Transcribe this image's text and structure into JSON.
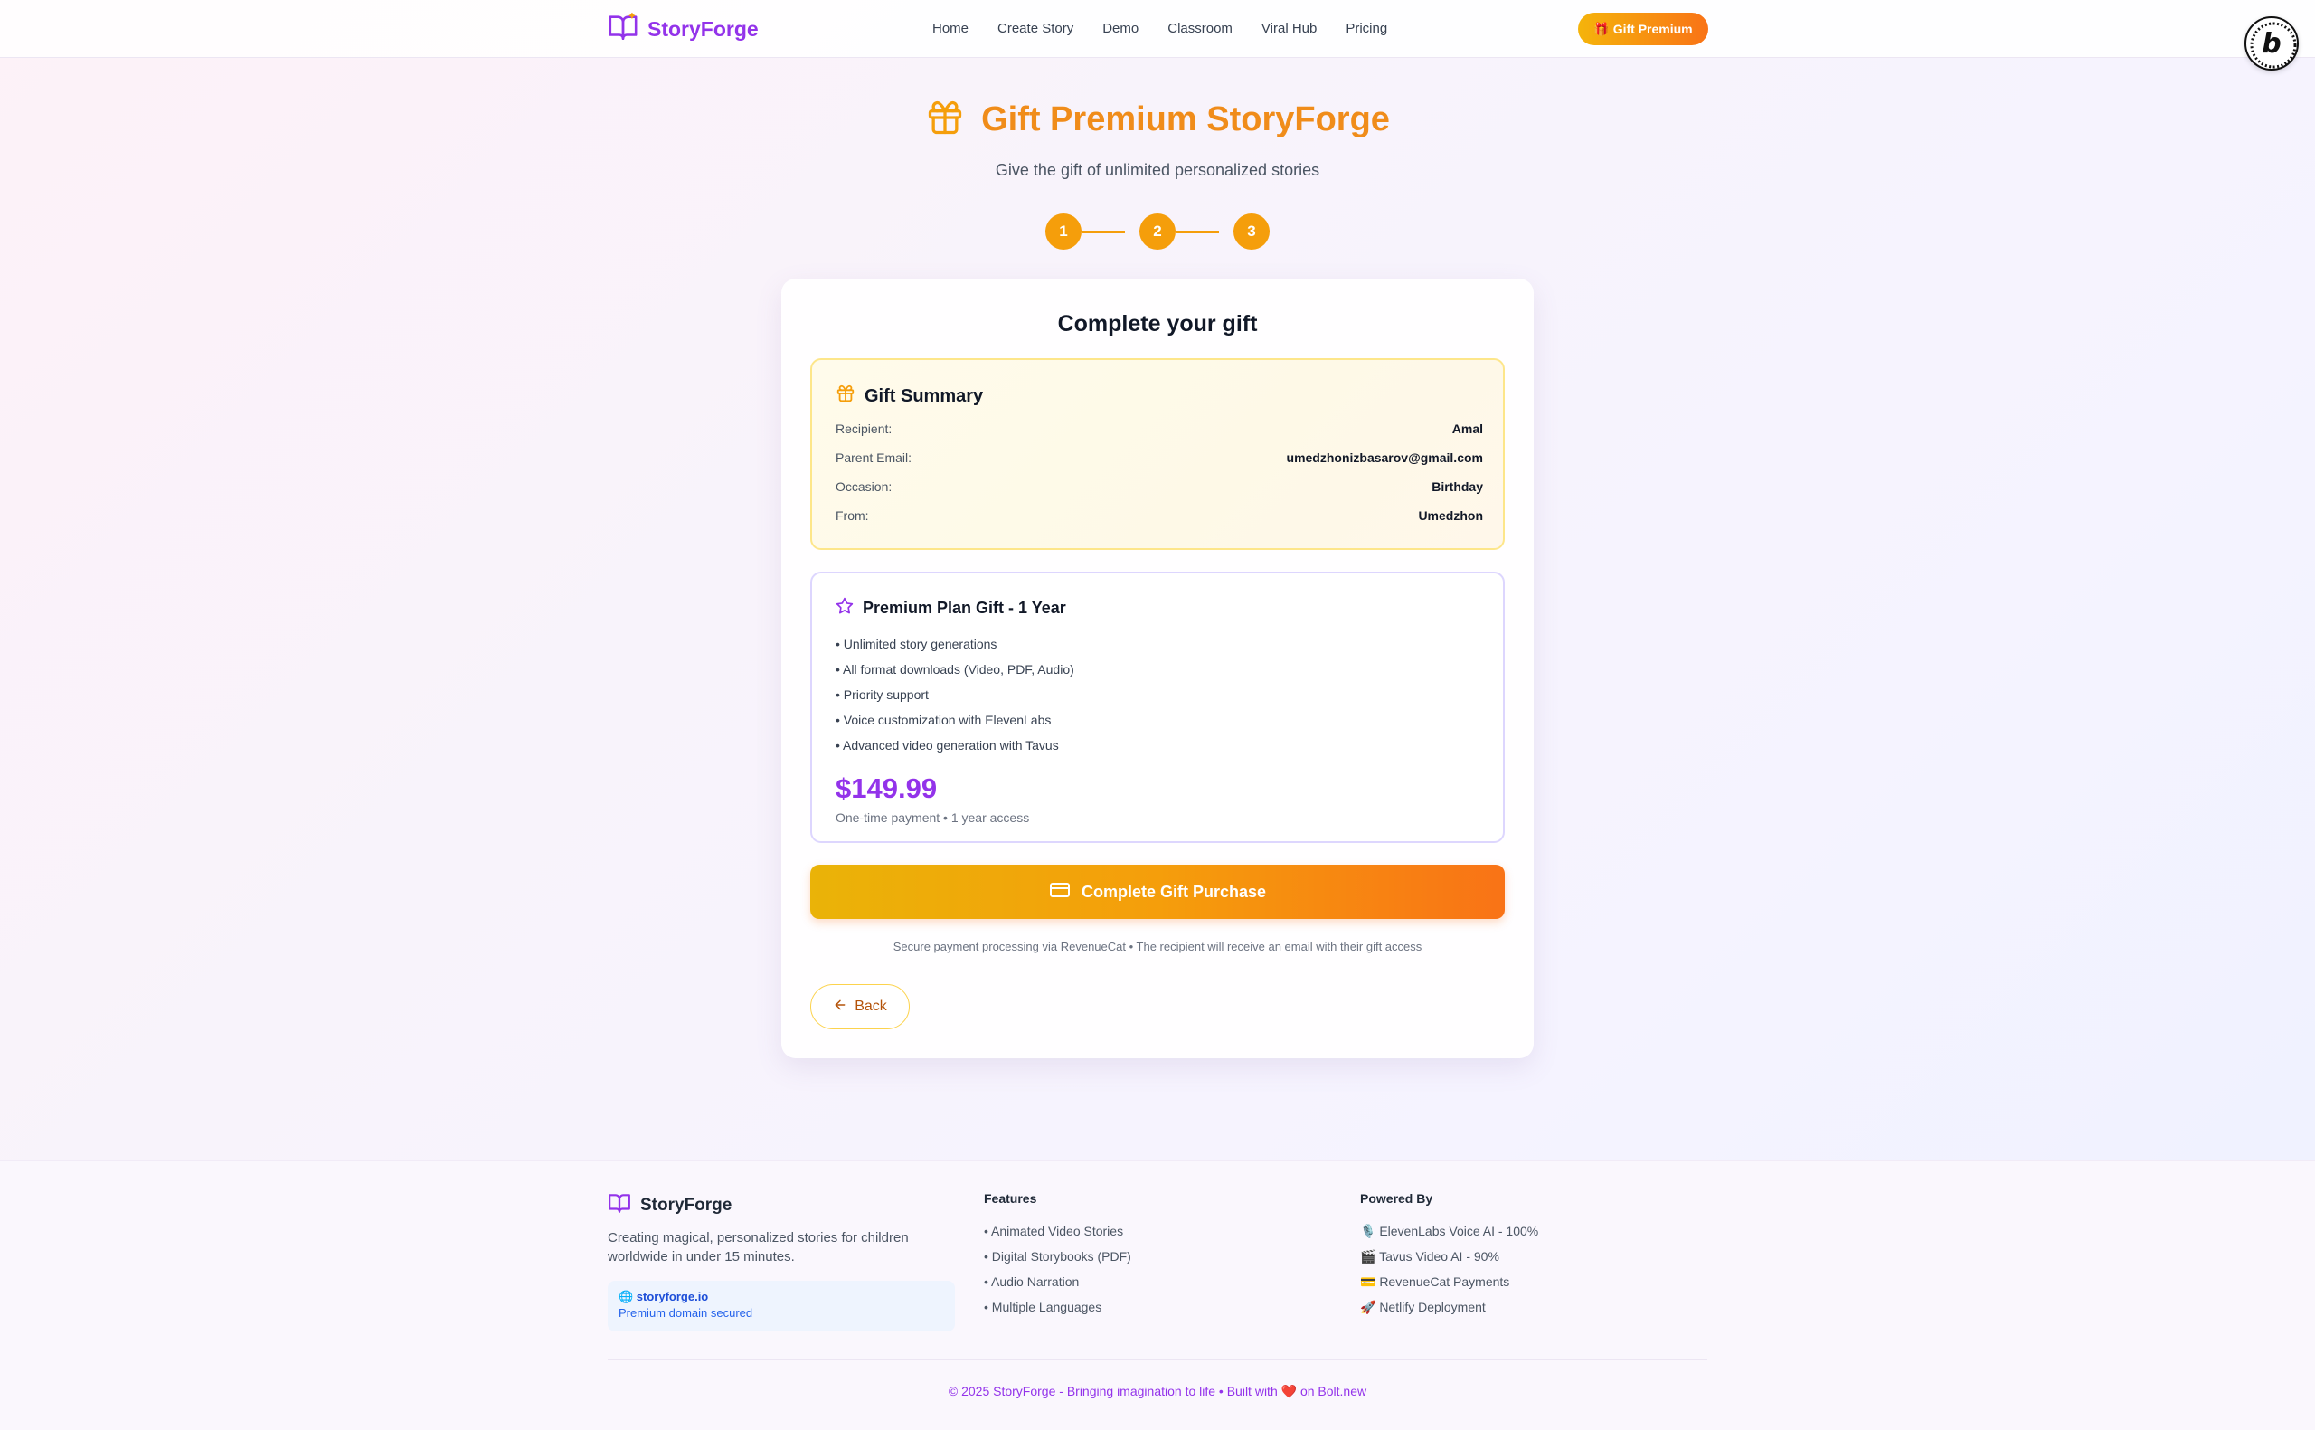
{
  "header": {
    "brand": "StoryForge",
    "nav": [
      "Home",
      "Create Story",
      "Demo",
      "Classroom",
      "Viral Hub",
      "Pricing"
    ],
    "gift_button": "🎁 Gift Premium"
  },
  "hero": {
    "title": "Gift Premium StoryForge",
    "subtitle": "Give the gift of unlimited personalized stories",
    "steps": [
      "1",
      "2",
      "3"
    ]
  },
  "card": {
    "title": "Complete your gift",
    "summary": {
      "heading": "Gift Summary",
      "rows": [
        {
          "label": "Recipient:",
          "value": "Amal"
        },
        {
          "label": "Parent Email:",
          "value": "umedzhonizbasarov@gmail.com"
        },
        {
          "label": "Occasion:",
          "value": "Birthday"
        },
        {
          "label": "From:",
          "value": "Umedzhon"
        }
      ]
    },
    "plan": {
      "heading": "Premium Plan Gift - 1 Year",
      "features": [
        "• Unlimited story generations",
        "• All format downloads (Video, PDF, Audio)",
        "• Priority support",
        "• Voice customization with ElevenLabs",
        "• Advanced video generation with Tavus"
      ],
      "price": "$149.99",
      "price_note": "One-time payment • 1 year access"
    },
    "purchase_button": "Complete Gift Purchase",
    "secure_note": "Secure payment processing via RevenueCat • The recipient will receive an email with their gift access",
    "back_button": "Back"
  },
  "footer": {
    "brand": "StoryForge",
    "description": "Creating magical, personalized stories for children worldwide in under 15 minutes.",
    "domain": "🌐 storyforge.io",
    "domain_note": "Premium domain secured",
    "features_heading": "Features",
    "features": [
      "• Animated Video Stories",
      "• Digital Storybooks (PDF)",
      "• Audio Narration",
      "• Multiple Languages"
    ],
    "powered_heading": "Powered By",
    "powered": [
      "🎙️ ElevenLabs Voice AI - 100%",
      "🎬 Tavus Video AI - 90%",
      "💳 RevenueCat Payments",
      "🚀 Netlify Deployment"
    ],
    "copyright": "© 2025 StoryForge - Bringing imagination to life • Built with ❤️ on Bolt.new"
  },
  "colors": {
    "brand_purple": "#9333ea",
    "accent_orange": "#f59e0b",
    "button_gradient_end": "#f97316"
  },
  "icons": {
    "brand": "open-book-icon",
    "hero": "gift-icon",
    "summary": "gift-icon",
    "plan": "star-icon",
    "purchase": "credit-card-icon",
    "back": "arrow-left-icon"
  }
}
